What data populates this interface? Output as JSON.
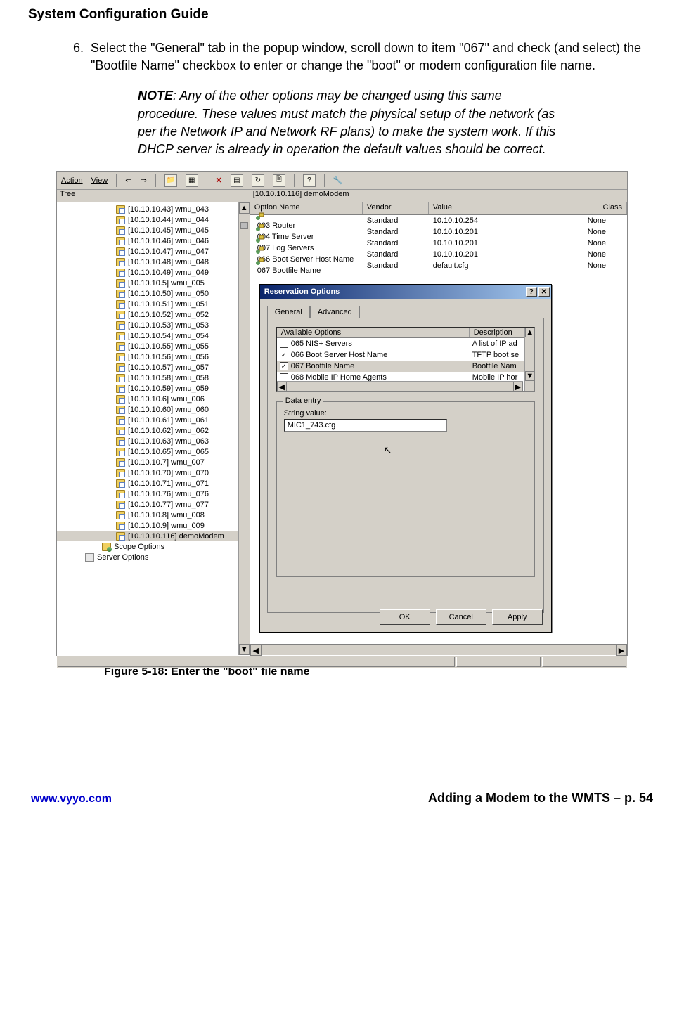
{
  "doc_title": "System Configuration Guide",
  "step_num": "6.",
  "step_text": "Select the \"General\" tab in the popup window, scroll down to item \"067\" and check (and select) the \"Bootfile Name\" checkbox to enter or change the \"boot\" or modem configuration file name.",
  "note_label": "NOTE",
  "note_text": ": Any of the other options may be changed using this same procedure.  These values must match the physical setup of the network (as per the Network IP and Network RF plans) to make the system work.  If this DHCP server is already in operation the default values should be correct.",
  "toolbar": {
    "action": "Action",
    "view": "View"
  },
  "tree_label": "Tree",
  "tree_items": [
    "[10.10.10.43] wmu_043",
    "[10.10.10.44] wmu_044",
    "[10.10.10.45] wmu_045",
    "[10.10.10.46] wmu_046",
    "[10.10.10.47] wmu_047",
    "[10.10.10.48] wmu_048",
    "[10.10.10.49] wmu_049",
    "[10.10.10.5] wmu_005",
    "[10.10.10.50] wmu_050",
    "[10.10.10.51] wmu_051",
    "[10.10.10.52] wmu_052",
    "[10.10.10.53] wmu_053",
    "[10.10.10.54] wmu_054",
    "[10.10.10.55] wmu_055",
    "[10.10.10.56] wmu_056",
    "[10.10.10.57] wmu_057",
    "[10.10.10.58] wmu_058",
    "[10.10.10.59] wmu_059",
    "[10.10.10.6] wmu_006",
    "[10.10.10.60] wmu_060",
    "[10.10.10.61] wmu_061",
    "[10.10.10.62] wmu_062",
    "[10.10.10.63] wmu_063",
    "[10.10.10.65] wmu_065",
    "[10.10.10.7] wmu_007",
    "[10.10.10.70] wmu_070",
    "[10.10.10.71] wmu_071",
    "[10.10.10.76] wmu_076",
    "[10.10.10.77] wmu_077",
    "[10.10.10.8] wmu_008",
    "[10.10.10.9] wmu_009",
    "[10.10.10.116] demoModem"
  ],
  "tree_scope": "Scope Options",
  "tree_server": "Server Options",
  "main_caption": "[10.10.10.116] demoModem",
  "cols": {
    "name": "Option Name",
    "vendor": "Vendor",
    "value": "Value",
    "class": "Class"
  },
  "option_rows": [
    {
      "name": "003 Router",
      "vendor": "Standard",
      "value": "10.10.10.254",
      "class": "None"
    },
    {
      "name": "004 Time Server",
      "vendor": "Standard",
      "value": "10.10.10.201",
      "class": "None"
    },
    {
      "name": "007 Log Servers",
      "vendor": "Standard",
      "value": "10.10.10.201",
      "class": "None"
    },
    {
      "name": "066 Boot Server Host Name",
      "vendor": "Standard",
      "value": "10.10.10.201",
      "class": "None"
    },
    {
      "name": "067 Bootfile Name",
      "vendor": "Standard",
      "value": "default.cfg",
      "class": "None"
    }
  ],
  "dialog": {
    "title": "Reservation Options",
    "tab_general": "General",
    "tab_advanced": "Advanced",
    "avail_label": "Available Options",
    "desc_label": "Description",
    "rows": [
      {
        "checked": false,
        "name": "065 NIS+ Servers",
        "desc": "A list of IP ad"
      },
      {
        "checked": true,
        "name": "066 Boot Server Host Name",
        "desc": "TFTP boot se"
      },
      {
        "checked": true,
        "name": "067 Bootfile Name",
        "desc": "Bootfile Nam",
        "selected": true
      },
      {
        "checked": false,
        "name": "068 Mobile IP Home Agents",
        "desc": "Mobile IP hor"
      }
    ],
    "data_entry_label": "Data entry",
    "string_label": "String value:",
    "string_value": "MIC1_743.cfg",
    "ok": "OK",
    "cancel": "Cancel",
    "apply": "Apply",
    "help": "?",
    "close": "✕"
  },
  "figure_caption": "Figure 5-18: Enter the \"boot\" file name",
  "footer_link": "www.vyyo.com",
  "footer_right": "Adding a Modem to the WMTS – p. 54"
}
